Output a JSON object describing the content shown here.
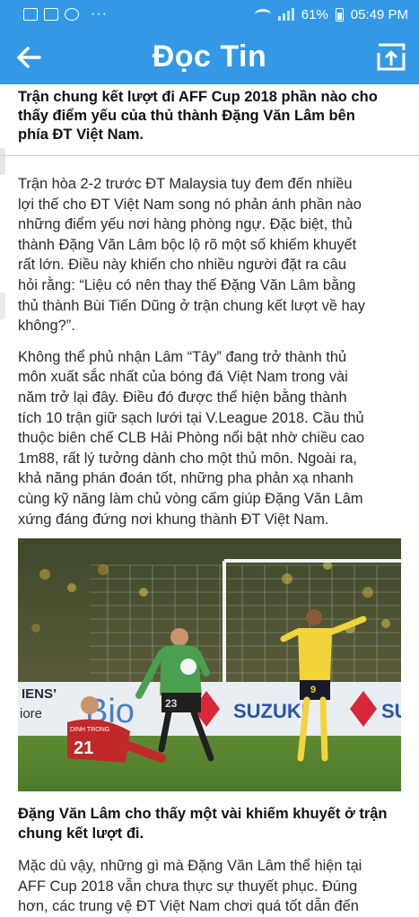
{
  "status_bar": {
    "battery": "61%",
    "time": "05:49 PM",
    "dots": "···"
  },
  "app_bar": {
    "title": "Đọc Tin",
    "back_icon": "arrow-left-icon",
    "share_icon": "open-external-icon"
  },
  "article": {
    "title_lines": [
      "Trận chung kết lượt đi AFF Cup 2018 phần nào cho",
      "thấy điểm yếu của thủ thành Đặng Văn Lâm bên",
      "phía ĐT Việt Nam."
    ],
    "para1": [
      "Trận hòa 2-2 trước ĐT Malaysia tuy đem đến nhiều",
      "lợi thế cho ĐT Việt Nam song nó phản ánh phần nào",
      "những điểm yếu nơi hàng phòng ngự. Đặc biệt, thủ",
      "thành Đặng Văn Lâm bộc lộ rõ một số khiếm khuyết",
      "rất lớn. Điều này khiến cho nhiều người đặt ra câu",
      "hỏi rằng: “Liệu có nên thay thế Đặng Văn Lâm bằng",
      "thủ thành Bùi Tiến Dũng ở trận chung kết lượt về hay",
      "không?”."
    ],
    "para2": [
      "Không thể phủ nhận Lâm “Tây” đang trở thành thủ",
      "môn xuất sắc nhất của bóng đá Việt Nam trong vài",
      "năm trở lại đây. Điều đó được thể hiện bằng thành",
      "tích 10 trận giữ sạch lưới tại V.League 2018. Cầu thủ",
      "thuộc biên chế CLB Hải Phòng nổi bật nhờ chiều cao",
      "1m88, rất lý tưởng dành cho một thủ môn. Ngoài ra,",
      "khả năng phán đoán tốt, những pha phản xạ nhanh",
      "cùng kỹ năng làm chủ vòng cấm giúp Đặng Văn Lâm",
      "xứng đáng đứng nơi khung thành ĐT Việt Nam."
    ],
    "photo": {
      "board_left": "IENS’",
      "board_left2": "iore",
      "board_mid": "Bio",
      "board_right": "SUZUKI",
      "board_far": "SU",
      "keeper_number": "23",
      "defender_number": "21",
      "defender_name": "DINH TRONG",
      "attacker_number": "9"
    },
    "caption_lines": [
      "Đặng Văn Lâm cho thấy một vài khiếm khuyết ở trận",
      "chung kết lượt đi."
    ],
    "para3": [
      "Mặc dù vậy, những gì mà Đặng Văn Lâm thể hiện tại",
      "AFF Cup 2018 vẫn chưa thực sự thuyết phục. Đúng",
      "hơn, các trung vệ ĐT Việt Nam chơi quá tốt dẫn đến"
    ]
  },
  "colors": {
    "accent": "#3399e6",
    "text": "#2a2a2a"
  }
}
